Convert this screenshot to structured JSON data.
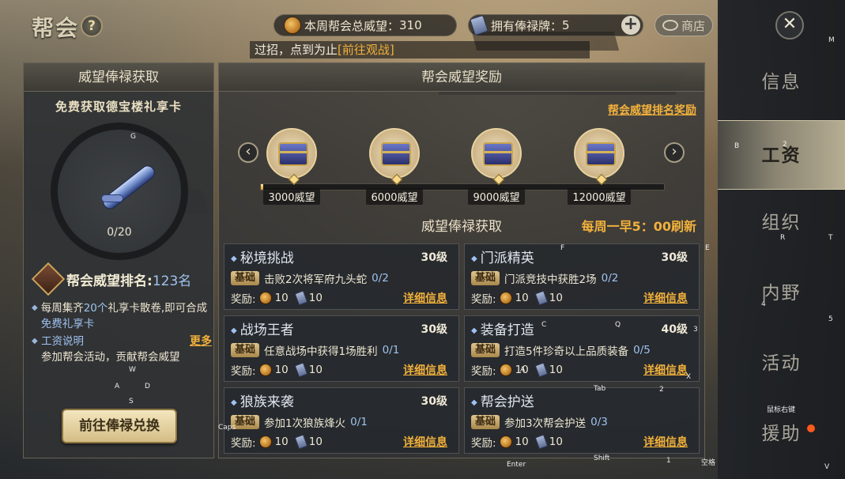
{
  "header": {
    "title": "帮会",
    "help_icon": "?",
    "prestige_label": "本周帮会总威望：",
    "prestige_value": "310",
    "salary_label": "拥有俸禄牌：",
    "salary_value": "5",
    "plus_label": "+",
    "shop_label": "商店"
  },
  "marquee": {
    "text": "过招，点到为止",
    "link": "[前往观战]"
  },
  "left_panel": {
    "title": "威望俸禄获取",
    "free_title": "免费获取德宝楼礼享卡",
    "progress": "0/20",
    "rank_label": "帮会威望排名:",
    "rank_value": "123名",
    "bullet1_pre": "每周集齐",
    "bullet1_count": "20个",
    "bullet1_mid": "礼享卡散卷,即可合成",
    "bullet1_link": "免费礼享卡",
    "wage_title": "工资说明",
    "more_label": "更多",
    "wage_desc": "参加帮会活动，贡献帮会威望",
    "exchange_button": "前往俸禄兑换"
  },
  "main_panel": {
    "title": "帮会威望奖励",
    "rank_reward_link": "帮会威望排名奖励",
    "prev_arrow": "‹",
    "next_arrow": "›",
    "progress_fraction": 0.005,
    "milestones": [
      {
        "label": "3000威望"
      },
      {
        "label": "6000威望"
      },
      {
        "label": "9000威望"
      },
      {
        "label": "12000威望"
      }
    ],
    "sub_title": "威望俸禄获取",
    "refresh_text": "每周一早5：00刷新",
    "tasks": [
      {
        "name": "秘境挑战",
        "level": "30级",
        "tag": "基础",
        "desc": "击败2次将军府九头蛇",
        "progress": "0/2",
        "reward_label": "奖励:",
        "coin": "10",
        "token": "10",
        "detail": "详细信息"
      },
      {
        "name": "门派精英",
        "level": "30级",
        "tag": "基础",
        "desc": "门派竞技中获胜2场",
        "progress": "0/2",
        "reward_label": "奖励:",
        "coin": "10",
        "token": "10",
        "detail": "详细信息"
      },
      {
        "name": "战场王者",
        "level": "30级",
        "tag": "基础",
        "desc": "任意战场中获得1场胜利",
        "progress": "0/1",
        "reward_label": "奖励:",
        "coin": "10",
        "token": "10",
        "detail": "详细信息"
      },
      {
        "name": "装备打造",
        "level": "40级",
        "tag": "基础",
        "desc": "打造5件珍奇以上品质装备",
        "progress": "0/5",
        "reward_label": "奖励:",
        "coin": "10",
        "token": "10",
        "detail": "详细信息"
      },
      {
        "name": "狼族来袭",
        "level": "30级",
        "tag": "基础",
        "desc": "参加1次狼族烽火",
        "progress": "0/1",
        "reward_label": "奖励:",
        "coin": "10",
        "token": "10",
        "detail": "详细信息"
      },
      {
        "name": "帮会护送",
        "level": "",
        "tag": "基础",
        "desc": "参加3次帮会护送",
        "progress": "0/3",
        "reward_label": "奖励:",
        "coin": "10",
        "token": "10",
        "detail": "详细信息"
      }
    ]
  },
  "sidebar": {
    "close_icon": "✕",
    "tabs": [
      {
        "label": "信息",
        "active": false
      },
      {
        "label": "工资",
        "active": true
      },
      {
        "label": "组织",
        "active": false
      },
      {
        "label": "内野",
        "active": false
      },
      {
        "label": "活动",
        "active": false
      },
      {
        "label": "援助",
        "active": false,
        "notify": true
      }
    ]
  },
  "key_hints": {
    "g": "G",
    "m": "M",
    "b": "B",
    "two_a": "2",
    "f": "F",
    "e": "E",
    "r": "R",
    "t": "T",
    "four": "4",
    "five": "5",
    "c": "C",
    "q": "Q",
    "three": "3",
    "w": "W",
    "a": "A",
    "d": "D",
    "s": "S",
    "x": "X",
    "tab": "Tab",
    "two_b": "2",
    "mouse": "鼠标右键",
    "caps": "Caps",
    "enter": "Enter",
    "shift": "Shift",
    "one": "1",
    "space": "空格",
    "v": "V",
    "a2": "A"
  },
  "colors": {
    "accent_gold": "#f2b13b",
    "progress_blue": "#9fc3f0",
    "notify_red": "#ff5a1c"
  }
}
